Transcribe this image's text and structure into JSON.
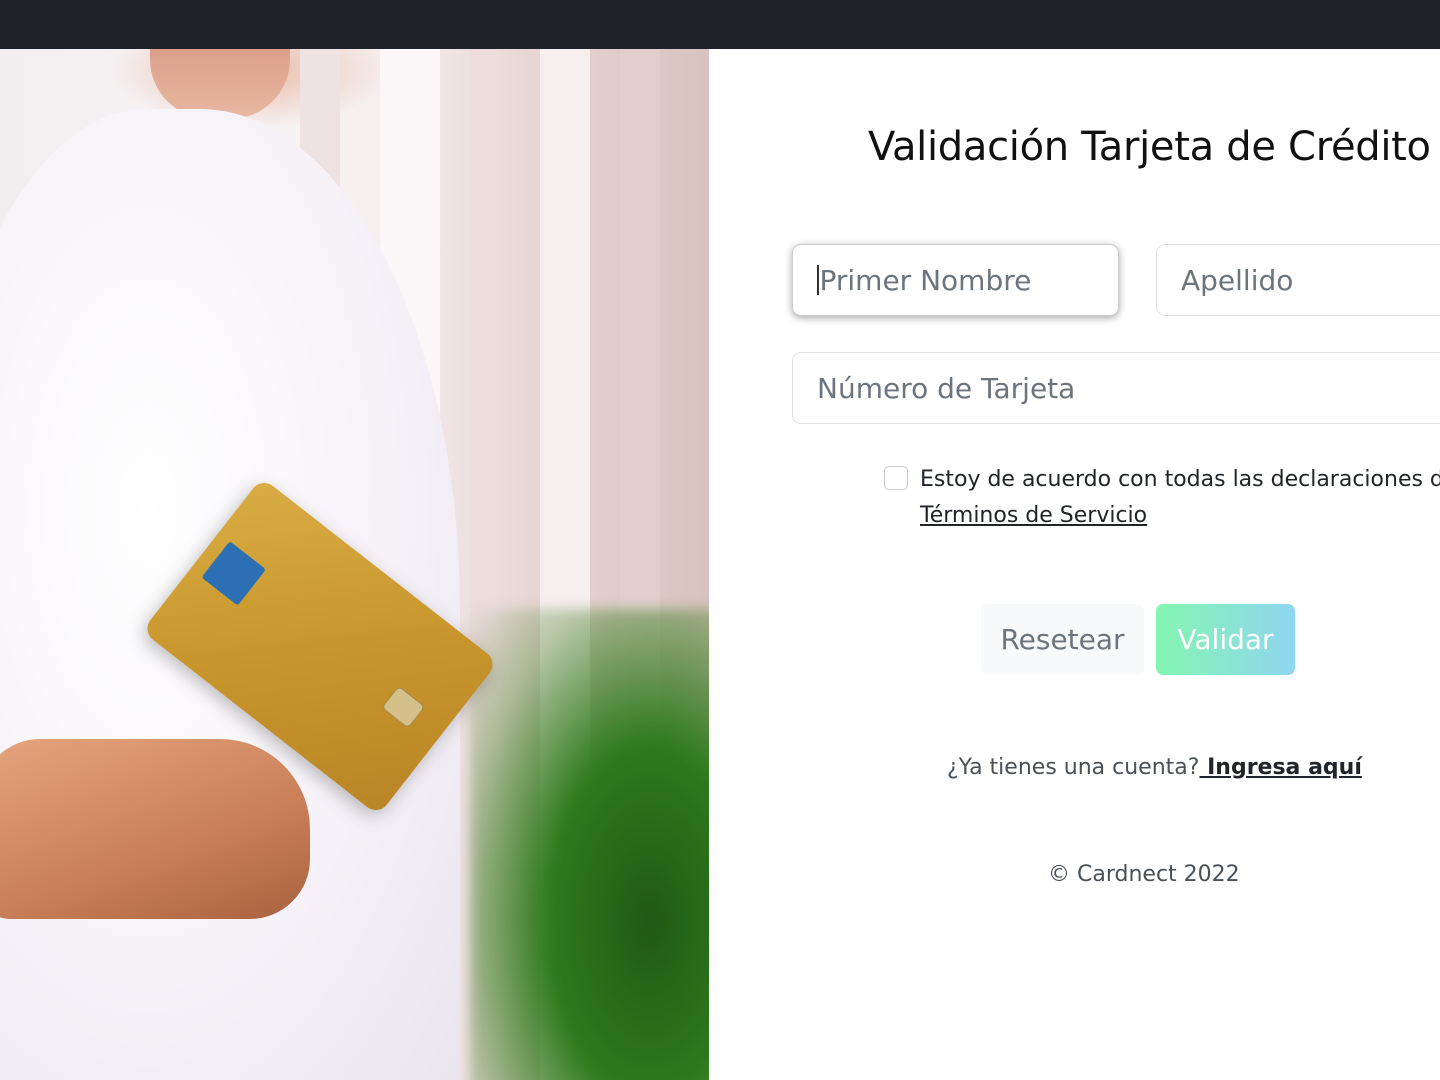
{
  "form": {
    "title": "Validación Tarjeta de Crédito",
    "first_name_placeholder": "Primer Nombre",
    "last_name_placeholder": "Apellido",
    "card_number_placeholder": "Número de Tarjeta",
    "agreement_text": "Estoy de acuerdo con todas las declaraciones de l",
    "terms_link": "Términos de Servicio",
    "reset_label": "Resetear",
    "validate_label": "Validar"
  },
  "account": {
    "prompt": "¿Ya tienes una cuenta?",
    "login_link": " Ingresa aquí"
  },
  "footer": {
    "copyright": "© Cardnect 2022"
  },
  "colors": {
    "topbar": "#1f2228",
    "validate_gradient_start": "#84f5b0",
    "validate_gradient_end": "#8fd6f0",
    "reset_bg": "#f8f9fa"
  },
  "image": {
    "subject": "person-holding-credit-card-photo"
  }
}
